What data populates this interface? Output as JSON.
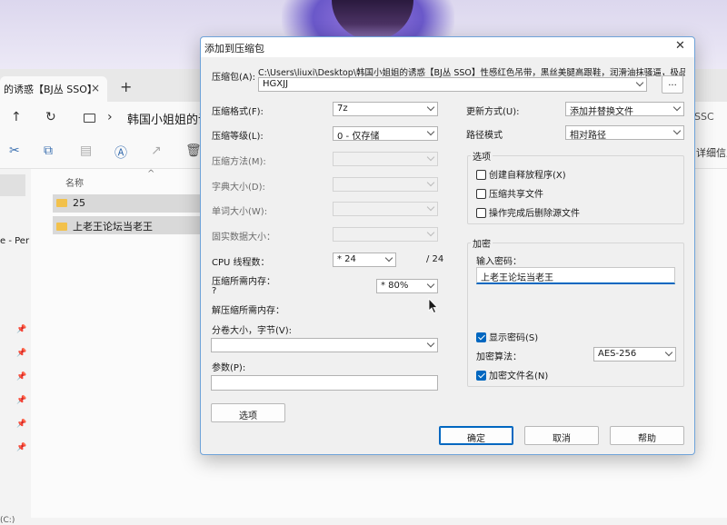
{
  "explorer": {
    "tab_title": "的诱惑【BJ丛 SSO】",
    "tab_close": "×",
    "tab_new": "+",
    "nav_up": "↑",
    "nav_refresh": "↻",
    "nav_chevron": "›",
    "address": "韩国小姐姐的诱",
    "address_right": "SSC",
    "toolbar_right": "详细信息",
    "sidebar_partial": "e - Per",
    "sidebar_bottom": "(C:)",
    "column_name": "名称",
    "files": [
      "25",
      "上老王论坛当老王"
    ]
  },
  "dialog": {
    "title": "添加到压缩包",
    "close": "✕",
    "archive_label": "压缩包(A):",
    "archive_path": "C:\\Users\\liuxi\\Desktop\\韩国小姐姐的诱惑【BJ丛 SSO】性感红色吊带，黑丝美腿高跟鞋，润滑油抹骚逼，极品美",
    "archive_name": "HGXJJ",
    "browse_button": "...",
    "format_label": "压缩格式(F):",
    "format_value": "7z",
    "level_label": "压缩等级(L):",
    "level_value": "0 - 仅存储",
    "method_label": "压缩方法(M):",
    "dict_label": "字典大小(D):",
    "word_label": "单词大小(W):",
    "solid_label": "固实数据大小：",
    "threads_label": "CPU 线程数：",
    "threads_value": "* 24",
    "threads_max": "/ 24",
    "mem_comp_label": "压缩所需内存：",
    "mem_comp_q": "?",
    "mem_comp_value": "* 80%",
    "mem_decomp_label": "解压缩所需内存：",
    "split_label": "分卷大小，字节(V):",
    "params_label": "参数(P):",
    "options_button": "选项",
    "update_label": "更新方式(U):",
    "update_value": "添加并替换文件",
    "pathmode_label": "路径模式",
    "pathmode_value": "相对路径",
    "options_group": "选项",
    "opt_sfx": "创建自释放程序(X)",
    "opt_shared": "压缩共享文件",
    "opt_delete": "操作完成后删除源文件",
    "encrypt_group": "加密",
    "password_label": "输入密码：",
    "password_value": "上老王论坛当老王",
    "show_password": "显示密码(S)",
    "enc_method_label": "加密算法：",
    "enc_method_value": "AES-256",
    "encrypt_names": "加密文件名(N)",
    "ok_button": "确定",
    "cancel_button": "取消",
    "help_button": "帮助"
  },
  "colors": {
    "accent": "#0067c0",
    "dialog_border": "#6fa3d9",
    "folder": "#f2c14b"
  }
}
